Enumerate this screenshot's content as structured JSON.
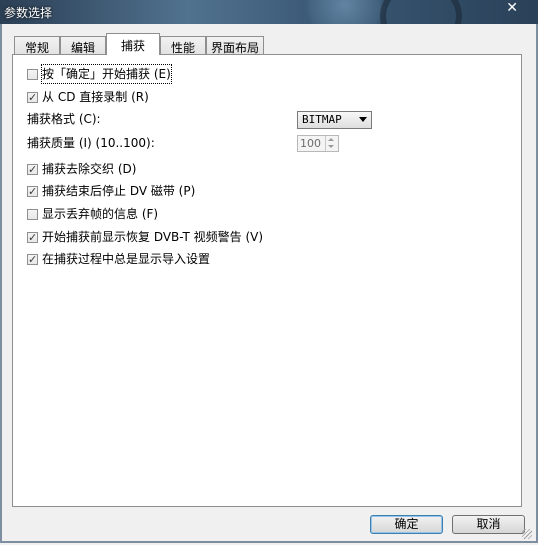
{
  "window": {
    "title": "参数选择",
    "close_glyph": "✕"
  },
  "tabs": [
    {
      "label": "常规",
      "active": false
    },
    {
      "label": "编辑",
      "active": false
    },
    {
      "label": "捕获",
      "active": true
    },
    {
      "label": "性能",
      "active": false
    },
    {
      "label": "界面布局",
      "active": false
    }
  ],
  "capture": {
    "press_ok_to_start": {
      "label": "按「确定」开始捕获 (E)",
      "checked": false
    },
    "record_from_cd": {
      "label": "从 CD 直接录制 (R)",
      "checked": true
    },
    "format_label": "捕获格式 (C):",
    "format_value": "BITMAP",
    "quality_label": "捕获质量 (I) (10..100):",
    "quality_value": "100",
    "deinterlace": {
      "label": "捕获去除交织 (D)",
      "checked": true
    },
    "stop_dv_tape": {
      "label": "捕获结束后停止 DV 磁带 (P)",
      "checked": true
    },
    "show_dropped_frames": {
      "label": "显示丢弃帧的信息 (F)",
      "checked": false
    },
    "dvbt_warning": {
      "label": "开始捕获前显示恢复 DVB-T 视频警告 (V)",
      "checked": true
    },
    "show_import_settings": {
      "label": "在捕获过程中总是显示导入设置",
      "checked": true
    }
  },
  "buttons": {
    "ok": "确定",
    "cancel": "取消"
  }
}
